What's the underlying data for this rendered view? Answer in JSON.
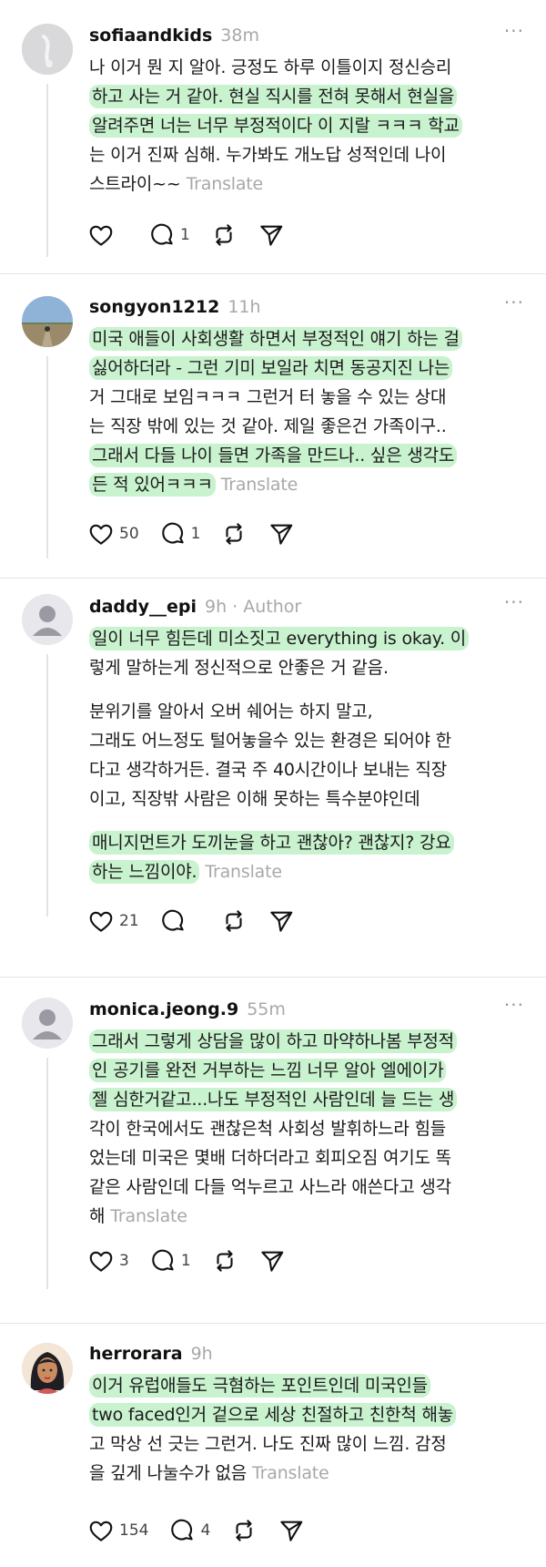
{
  "app": {
    "translate_label": "Translate",
    "more_label": "···"
  },
  "posts": [
    {
      "username": "sofiaandkids",
      "time": "38m",
      "author_badge": "",
      "lines": [
        "나 이거 뭔 지 알아. 긍정도 하루 이틀이지 정신승리",
        "하고 사는 거 같아. 현실 직시를 전혀 못해서 현실을",
        "알려주면 너는 너무 부정적이다 이 지랄 ㅋㅋㅋ 학교",
        "는 이거 진짜 심해. 누가봐도 개노답 성적인데 나이",
        "스트라이~~"
      ],
      "likes": "",
      "replies": "1"
    },
    {
      "username": "songyon1212",
      "time": "11h",
      "author_badge": "",
      "lines": [
        "미국 애들이 사회생활 하면서 부정적인 얘기 하는 걸",
        "싫어하더라 - 그런 기미 보일라 치면 동공지진 나는",
        "거 그대로 보임ㅋㅋㅋ 그런거 터 놓을 수 있는 상대",
        "는 직장 밖에 있는 것 같아. 제일 좋은건 가족이구..",
        "그래서 다들 나이 들면 가족을 만드나.. 싶은 생각도",
        "든 적 있어ㅋㅋㅋ"
      ],
      "likes": "50",
      "replies": "1"
    },
    {
      "username": "daddy__epi",
      "time": "9h",
      "author_badge": "· Author",
      "lines": [
        "일이 너무 힘든데 미소짓고 everything is okay. 이",
        "렇게 말하는게 정신적으로 안좋은 거 같음.",
        "분위기를 알아서 오버 쉐어는 하지 말고,",
        "그래도 어느정도 털어놓을수 있는 환경은 되어야 한",
        "다고 생각하거든. 결국 주 40시간이나 보내는 직장",
        "이고, 직장밖 사람은 이해 못하는 특수분야인데",
        "매니지먼트가 도끼눈을 하고 괜찮아? 괜찮지? 강요",
        "하는 느낌이야."
      ],
      "likes": "21",
      "replies": ""
    },
    {
      "username": "monica.jeong.9",
      "time": "55m",
      "author_badge": "",
      "lines": [
        "그래서 그렇게 상담을 많이 하고 마약하나봄 부정적",
        "인 공기를 완전 거부하는 느낌 너무 알아 엘에이가",
        "젤 심한거같고...나도 부정적인 사람인데 늘 드는 생",
        "각이 한국에서도 괜찮은척 사회성 발휘하느라 힘들",
        "었는데 미국은 몇배 더하더라고 회피오짐 여기도 똑",
        "같은 사람인데 다들 억누르고 사느라 애쓴다고 생각",
        "해"
      ],
      "likes": "3",
      "replies": "1"
    },
    {
      "username": "herrorara",
      "time": "9h",
      "author_badge": "",
      "lines": [
        "이거 유럽애들도 극혐하는 포인트인데 미국인들",
        "two faced인거 겉으로 세상 친절하고 친한척 해놓",
        "고 막상 선 긋는 그런거. 나도 진짜 많이 느낌. 감정",
        "을 깊게 나눌수가 없음"
      ],
      "likes": "154",
      "replies": "4"
    }
  ],
  "colors": {
    "highlight": "#c9f2cf",
    "muted": "#a8a8a8",
    "text": "#1a1a1a"
  },
  "icons": [
    "heart-icon",
    "comment-icon",
    "repost-icon",
    "send-icon",
    "more-icon"
  ]
}
